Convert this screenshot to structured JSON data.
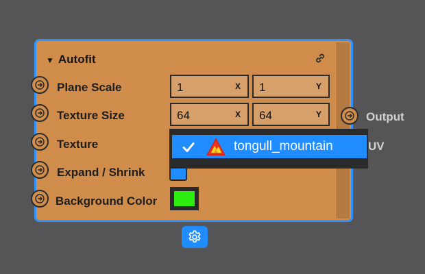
{
  "node": {
    "title": "Autofit",
    "rows": [
      {
        "label": "Plane Scale",
        "x_value": "1",
        "y_value": "1"
      },
      {
        "label": "Texture Size",
        "x_value": "64",
        "y_value": "64"
      },
      {
        "label": "Texture"
      },
      {
        "label": "Expand / Shrink",
        "checked": true
      },
      {
        "label": "Background Color",
        "color": "#2ded0f"
      }
    ],
    "axis_x": "X",
    "axis_y": "Y",
    "outputs": [
      {
        "label": "Output"
      },
      {
        "label": "UV"
      }
    ]
  },
  "dropdown": {
    "selected_item": "tongull_mountain",
    "checked": true
  },
  "colors": {
    "accent": "#1f8cff",
    "node_body": "#d08d4c",
    "canvas": "#2a2a2b"
  },
  "icons": [
    "chevron-down-icon",
    "link-icon",
    "arrow-right-icon",
    "check-icon",
    "mountain-asset-icon",
    "gear-icon"
  ]
}
